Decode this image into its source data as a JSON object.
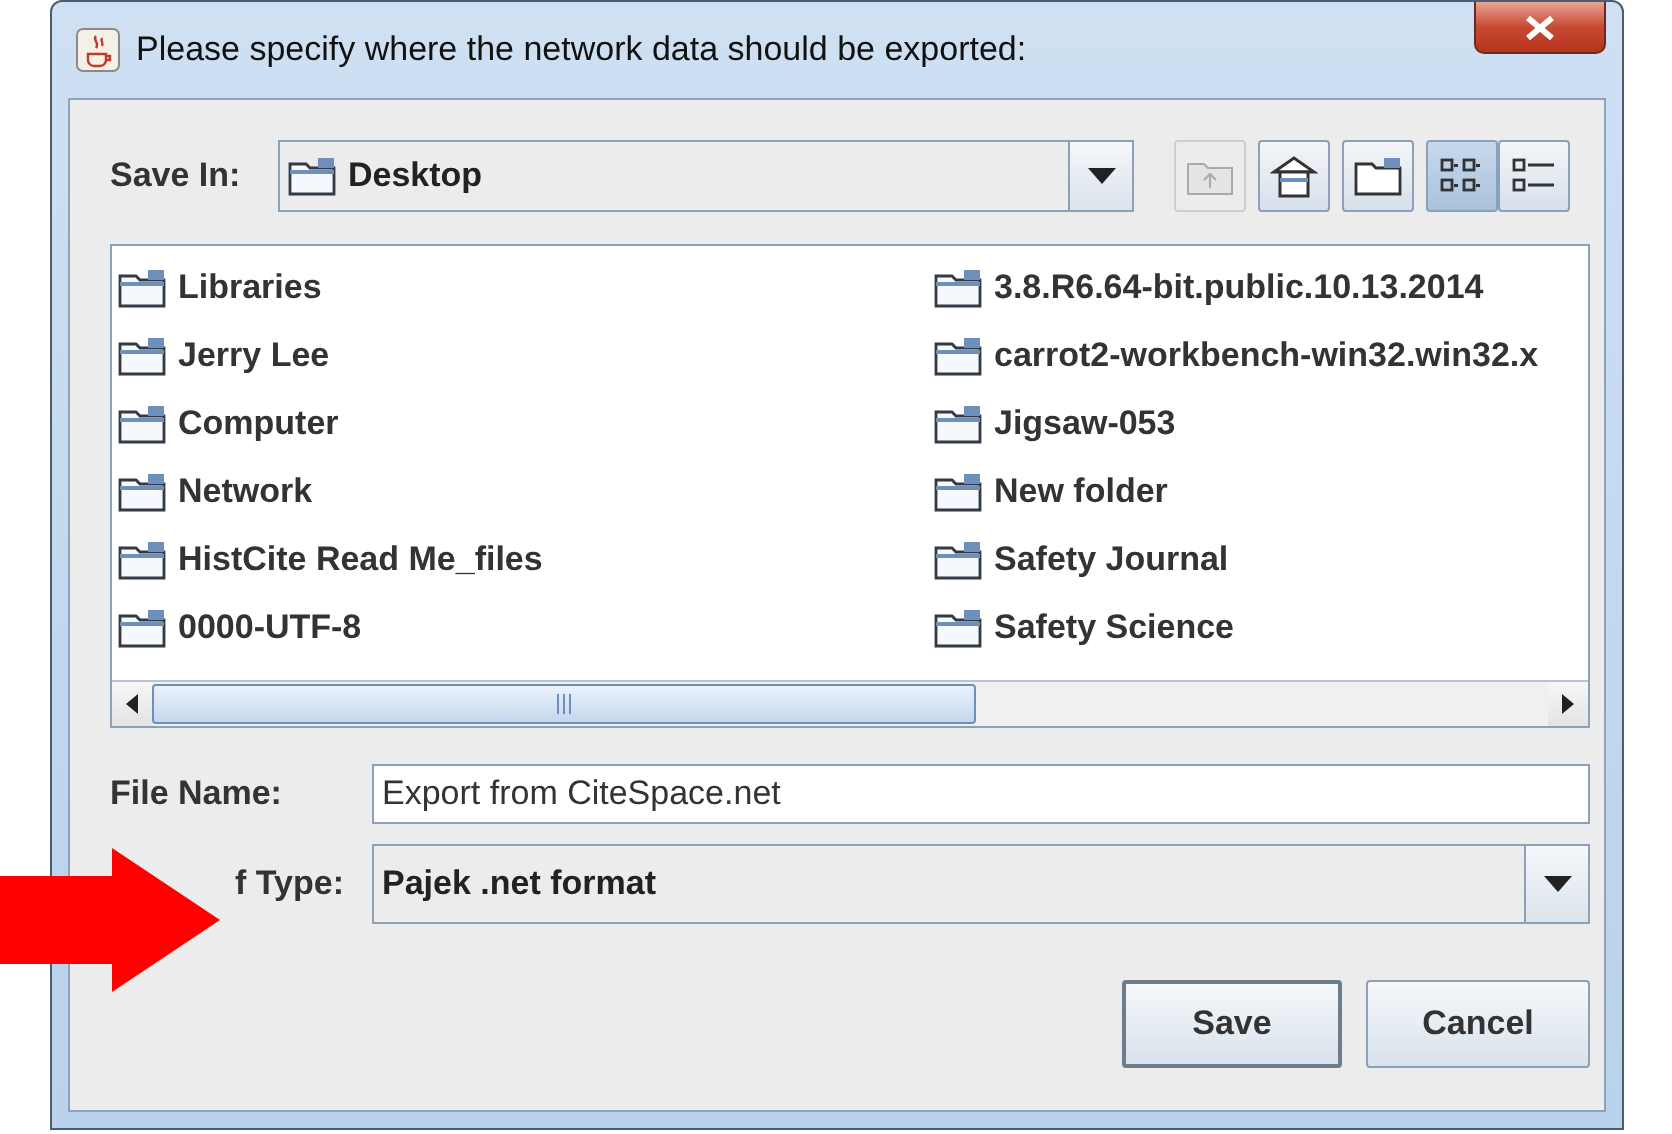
{
  "window": {
    "title": "Please specify where the network data should be exported:"
  },
  "save_in": {
    "label": "Save In:",
    "value": "Desktop"
  },
  "toolbar": [
    {
      "kind": "up",
      "disabled": true
    },
    {
      "kind": "home",
      "disabled": false
    },
    {
      "kind": "new_folder",
      "disabled": false
    }
  ],
  "view_toggle": [
    {
      "kind": "list",
      "selected": true
    },
    {
      "kind": "details",
      "selected": false
    }
  ],
  "files": [
    {
      "name": "Libraries"
    },
    {
      "name": "Jerry Lee"
    },
    {
      "name": "Computer"
    },
    {
      "name": "Network"
    },
    {
      "name": "HistCite Read Me_files"
    },
    {
      "name": "0000-UTF-8"
    },
    {
      "name": "3.8.R6.64-bit.public.10.13.2014"
    },
    {
      "name": "carrot2-workbench-win32.win32.x"
    },
    {
      "name": "Jigsaw-053"
    },
    {
      "name": "New folder"
    },
    {
      "name": "Safety Journal"
    },
    {
      "name": "Safety Science"
    }
  ],
  "file_name": {
    "label": "File Name:",
    "value": "Export from CiteSpace.net"
  },
  "file_type": {
    "label": "f Type:",
    "value": "Pajek .net format"
  },
  "buttons": [
    {
      "label": "Save",
      "default": true
    },
    {
      "label": "Cancel",
      "default": false
    }
  ]
}
